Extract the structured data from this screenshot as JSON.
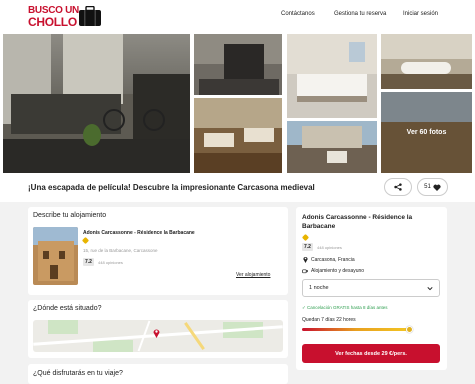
{
  "header": {
    "logo_line1": "BUSCO UN",
    "logo_line2": "CHOLLO",
    "nav": [
      "Contáctanos",
      "Gestiona tu reserva",
      "Iniciar sesión"
    ]
  },
  "gallery": {
    "see_all_label": "Ver 60 fotos"
  },
  "page": {
    "title": "¡Una escapada de película! Descubre la impresionante Carcasona medieval",
    "likes_count": "51"
  },
  "accommodation": {
    "section_title": "Describe tu alojamiento",
    "hotel_name": "Adonis Carcassonne - Résidence la Barbacane",
    "stars": 1,
    "address": "15, rue de la Barbacane, Carcassone",
    "rating": "7.2",
    "reviews": "448 opiniones",
    "link_label": "Ver alojamiento"
  },
  "location": {
    "section_title": "¿Dónde está situado?"
  },
  "enjoy": {
    "section_title": "¿Qué disfrutarás en tu viaje?"
  },
  "booking": {
    "hotel_name": "Adonis Carcassonne - Résidence la Barbacane",
    "stars": 1,
    "rating": "7.2",
    "reviews": "448 opiniones",
    "location": "Carcasona, Francia",
    "board": "Alojamiento y desayuno",
    "nights_option": "1 noche",
    "cancellation": "Cancelación GRATIS hasta 8 días antes",
    "time_left": "Quedan 7 días 22 hores",
    "time_left_fraction": 0.97,
    "cta_label": "Ver fechas desde 29 €/pers."
  },
  "colors": {
    "brand": "#c8102e",
    "green": "#2e9e4f",
    "rating_bg": "#e6e6e6"
  }
}
